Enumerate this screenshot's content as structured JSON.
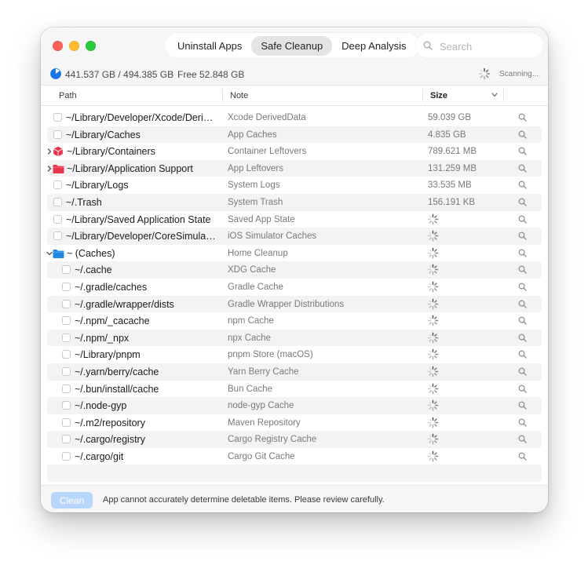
{
  "tabs": [
    {
      "label": "Uninstall Apps",
      "active": false
    },
    {
      "label": "Safe Cleanup",
      "active": true
    },
    {
      "label": "Deep Analysis",
      "active": false
    }
  ],
  "search": {
    "placeholder": "Search",
    "value": ""
  },
  "status": {
    "disk_usage": "441.537 GB / 494.385 GB",
    "free": "Free 52.848 GB",
    "scanning": "Scanning..."
  },
  "columns": {
    "path": "Path",
    "note": "Note",
    "size": "Size"
  },
  "rows": [
    {
      "path": "~/Library/Developer/Xcode/DerivedData",
      "note": "Xcode DerivedData",
      "size": "59.039 GB",
      "type": "checkbox",
      "level": 0
    },
    {
      "path": "~/Library/Caches",
      "note": "App Caches",
      "size": "4.835 GB",
      "type": "checkbox",
      "level": 0
    },
    {
      "path": "~/Library/Containers",
      "note": "Container Leftovers",
      "size": "789.621 MB",
      "type": "cube",
      "level": 0
    },
    {
      "path": "~/Library/Application Support",
      "note": "App Leftovers",
      "size": "131.259 MB",
      "type": "folder-red",
      "level": 0
    },
    {
      "path": "~/Library/Logs",
      "note": "System Logs",
      "size": "33.535 MB",
      "type": "checkbox",
      "level": 0
    },
    {
      "path": "~/.Trash",
      "note": "System Trash",
      "size": "156.191 KB",
      "type": "checkbox",
      "level": 0
    },
    {
      "path": "~/Library/Saved Application State",
      "note": "Saved App State",
      "size": "",
      "type": "checkbox",
      "level": 0
    },
    {
      "path": "~/Library/Developer/CoreSimulator",
      "note": "iOS Simulator Caches",
      "size": "",
      "type": "checkbox",
      "level": 0
    },
    {
      "path": "~ (Caches)",
      "note": "Home Cleanup",
      "size": "",
      "type": "folder-blue",
      "level": 0
    },
    {
      "path": "~/.cache",
      "note": "XDG Cache",
      "size": "",
      "type": "checkbox",
      "level": 1
    },
    {
      "path": "~/.gradle/caches",
      "note": "Gradle Cache",
      "size": "",
      "type": "checkbox",
      "level": 1
    },
    {
      "path": "~/.gradle/wrapper/dists",
      "note": "Gradle Wrapper Distributions",
      "size": "",
      "type": "checkbox",
      "level": 1
    },
    {
      "path": "~/.npm/_cacache",
      "note": "npm Cache",
      "size": "",
      "type": "checkbox",
      "level": 1
    },
    {
      "path": "~/.npm/_npx",
      "note": "npx Cache",
      "size": "",
      "type": "checkbox",
      "level": 1
    },
    {
      "path": "~/Library/pnpm",
      "note": "pnpm Store (macOS)",
      "size": "",
      "type": "checkbox",
      "level": 1
    },
    {
      "path": "~/.yarn/berry/cache",
      "note": "Yarn Berry Cache",
      "size": "",
      "type": "checkbox",
      "level": 1
    },
    {
      "path": "~/.bun/install/cache",
      "note": "Bun Cache",
      "size": "",
      "type": "checkbox",
      "level": 1
    },
    {
      "path": "~/.node-gyp",
      "note": "node-gyp Cache",
      "size": "",
      "type": "checkbox",
      "level": 1
    },
    {
      "path": "~/.m2/repository",
      "note": "Maven Repository",
      "size": "",
      "type": "checkbox",
      "level": 1
    },
    {
      "path": "~/.cargo/registry",
      "note": "Cargo Registry Cache",
      "size": "",
      "type": "checkbox",
      "level": 1
    },
    {
      "path": "~/.cargo/git",
      "note": "Cargo Git Cache",
      "size": "",
      "type": "checkbox",
      "level": 1
    }
  ],
  "footer": {
    "clean_label": "Clean",
    "warning": "App cannot accurately determine deletable items. Please review carefully."
  },
  "colors": {
    "accent": "#1a73e8",
    "clean_disabled": "#b8d6fb",
    "red_item": "#e8334a",
    "blue_folder": "#1e88e5"
  }
}
